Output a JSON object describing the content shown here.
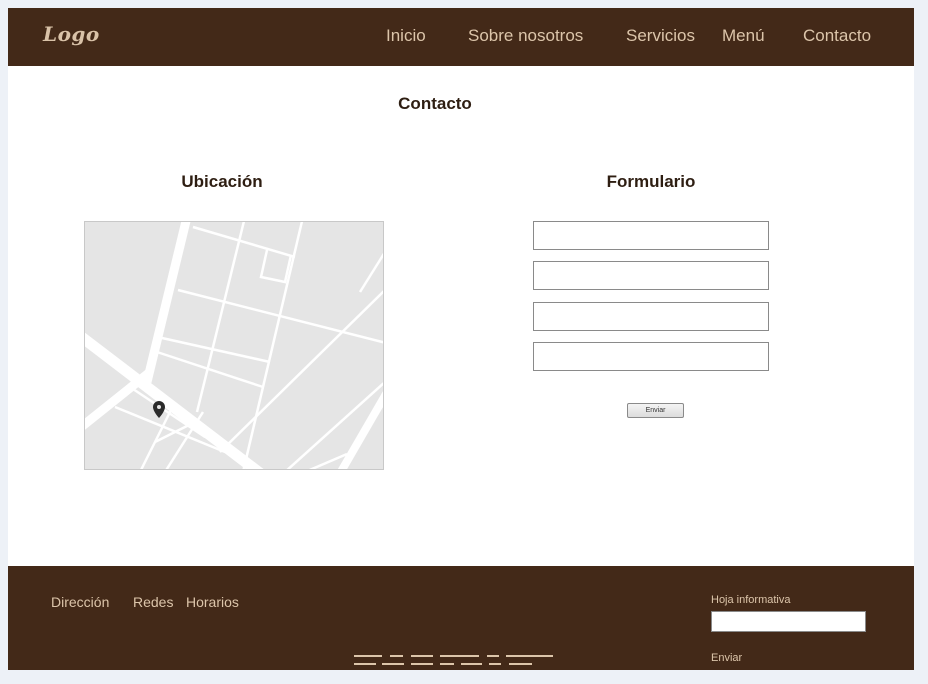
{
  "header": {
    "logo": "Logo",
    "nav": [
      {
        "label": "Inicio"
      },
      {
        "label": "Sobre nosotros"
      },
      {
        "label": "Servicios"
      },
      {
        "label": "Menú"
      },
      {
        "label": "Contacto"
      }
    ]
  },
  "main": {
    "title": "Contacto",
    "location": {
      "title": "Ubicación",
      "map_icon": "map-pin-icon"
    },
    "form": {
      "title": "Formulario",
      "fields": [
        {
          "value": "",
          "placeholder": ""
        },
        {
          "value": "",
          "placeholder": ""
        },
        {
          "value": "",
          "placeholder": ""
        },
        {
          "value": "",
          "placeholder": ""
        }
      ],
      "submit_label": "Enviar"
    }
  },
  "footer": {
    "links": [
      {
        "label": "Dirección"
      },
      {
        "label": "Redes"
      },
      {
        "label": "Horarios"
      }
    ],
    "newsletter": {
      "label": "Hoja informativa",
      "input_value": "",
      "button_label": "Enviar"
    }
  },
  "colors": {
    "brand_brown": "#432918",
    "text_beige": "#dcc5aa",
    "heading_dark": "#2e1e12",
    "map_gray": "#e5e5e5"
  }
}
